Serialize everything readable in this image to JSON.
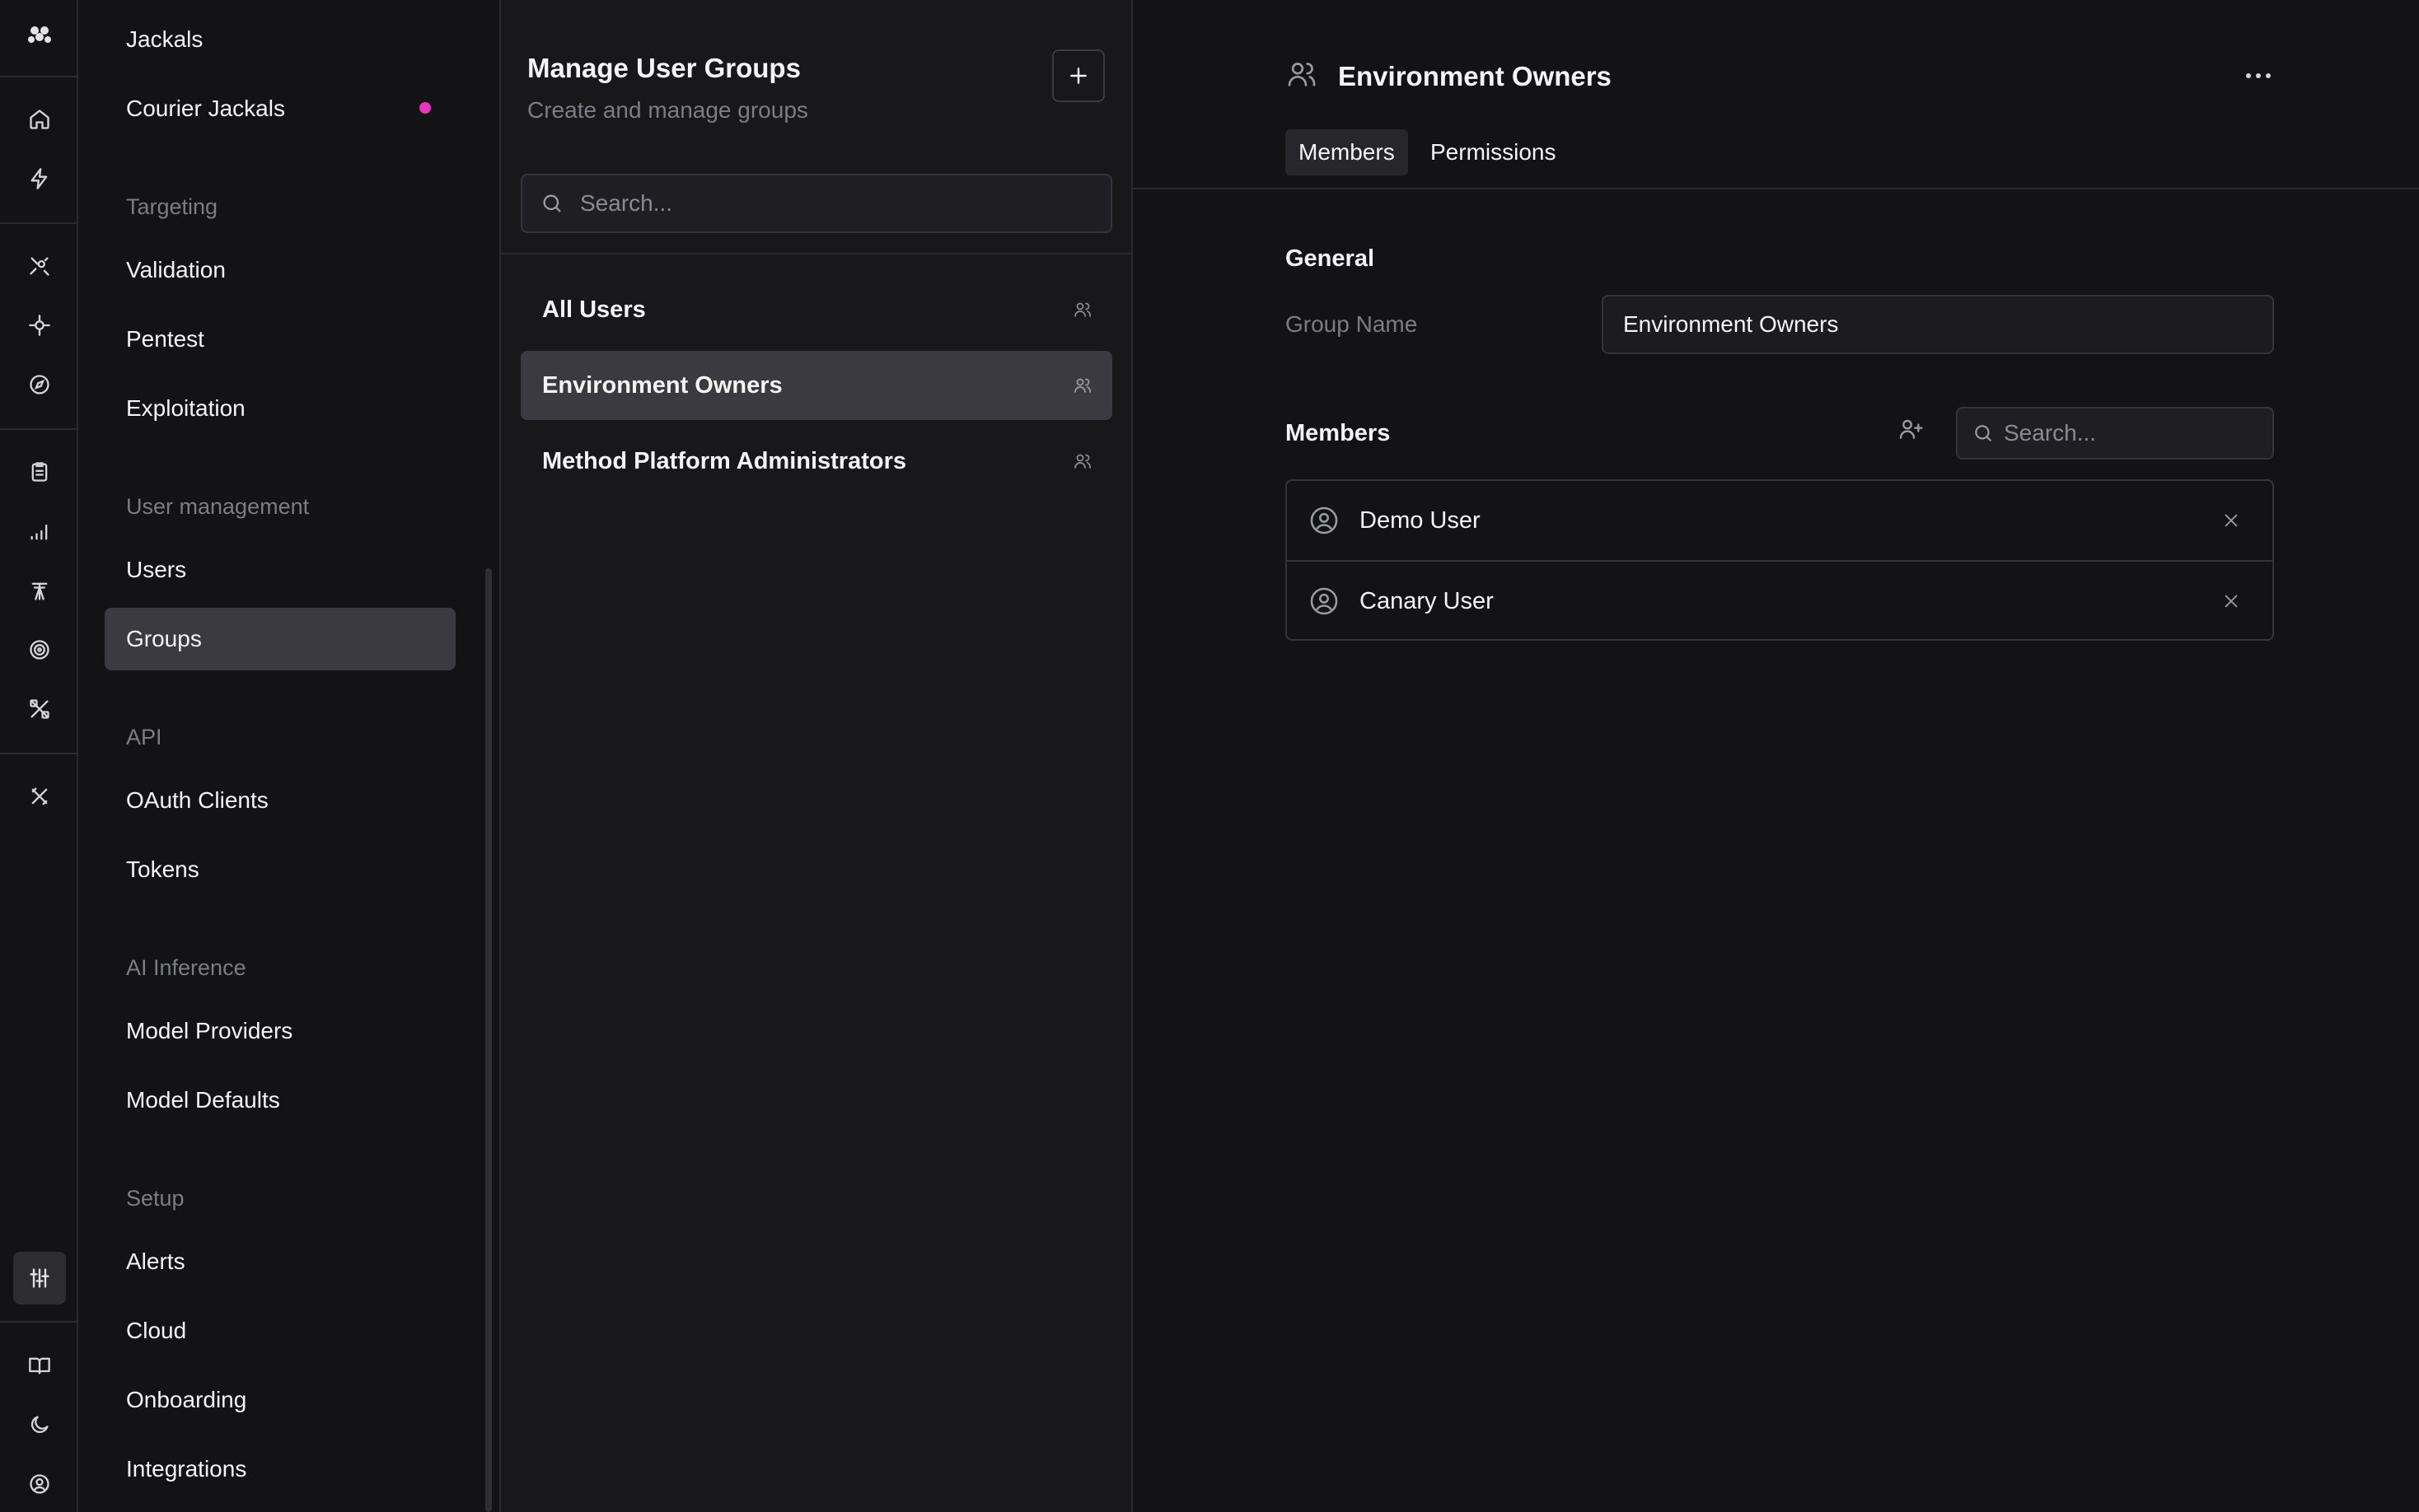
{
  "nav": {
    "items": [
      {
        "label": "Jackals"
      },
      {
        "label": "Courier Jackals"
      }
    ],
    "sections": [
      {
        "heading": "Targeting",
        "items": [
          "Validation",
          "Pentest",
          "Exploitation"
        ]
      },
      {
        "heading": "User management",
        "items": [
          "Users",
          "Groups"
        ]
      },
      {
        "heading": "API",
        "items": [
          "OAuth Clients",
          "Tokens"
        ]
      },
      {
        "heading": "AI Inference",
        "items": [
          "Model Providers",
          "Model Defaults"
        ]
      },
      {
        "heading": "Setup",
        "items": [
          "Alerts",
          "Cloud",
          "Onboarding",
          "Integrations"
        ]
      }
    ],
    "selected": "Groups",
    "notification_color": "#e935c1"
  },
  "rail_icons": [
    "logo-icon",
    "home-icon",
    "bolt-icon",
    "target-scan-icon",
    "network-icon",
    "compass-icon",
    "clipboard-icon",
    "signal-bars-icon",
    "tower-icon",
    "radar-icon",
    "tools-icon",
    "bug-x-icon",
    "settings-sliders-icon",
    "book-icon",
    "moon-icon",
    "user-circle-icon"
  ],
  "groups": {
    "title": "Manage User Groups",
    "subtitle": "Create and manage groups",
    "search_placeholder": "Search...",
    "list": [
      {
        "name": "All Users"
      },
      {
        "name": "Environment Owners"
      },
      {
        "name": "Method Platform Administrators"
      }
    ],
    "selected": "Environment Owners"
  },
  "detail": {
    "title": "Environment Owners",
    "tabs": [
      {
        "label": "Members"
      },
      {
        "label": "Permissions"
      }
    ],
    "active_tab": "Members",
    "general_heading": "General",
    "group_name_label": "Group Name",
    "group_name_value": "Environment Owners",
    "members_heading": "Members",
    "members_search_placeholder": "Search...",
    "members": [
      {
        "name": "Demo User"
      },
      {
        "name": "Canary User"
      }
    ]
  }
}
